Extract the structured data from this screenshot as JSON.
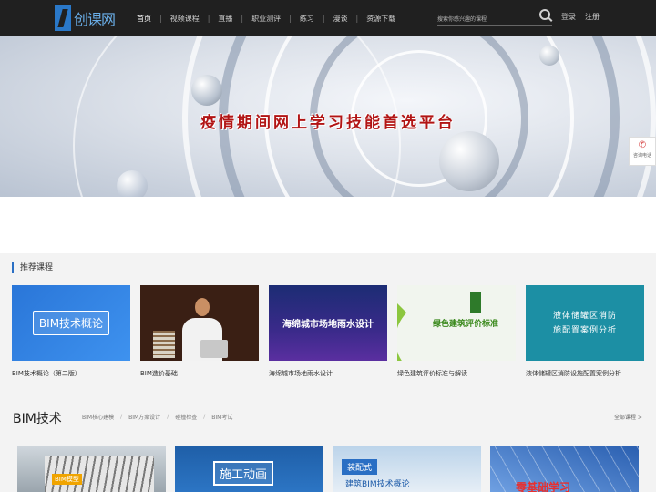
{
  "header": {
    "logo_text": "创课网",
    "nav": [
      {
        "label": "首页",
        "active": true
      },
      {
        "label": "视频课程",
        "active": false
      },
      {
        "label": "直播",
        "active": false
      },
      {
        "label": "职业测评",
        "active": false
      },
      {
        "label": "练习",
        "active": false
      },
      {
        "label": "漫谈",
        "active": false
      },
      {
        "label": "资源下载",
        "active": false
      }
    ],
    "search_placeholder": "搜索你感兴趣的课程",
    "login": "登录",
    "register": "注册"
  },
  "banner": {
    "title": "疫情期间网上学习技能首选平台"
  },
  "consult": {
    "label": "咨询电话",
    "icon": "phone-icon"
  },
  "recommended": {
    "title": "推荐课程",
    "courses": [
      {
        "title": "BIM技术概论（第二版）",
        "thumb_text": "BIM技术概论"
      },
      {
        "title": "BIM造价基础",
        "thumb_text": ""
      },
      {
        "title": "海绵城市场地雨水设计",
        "thumb_text": "海绵城市场地雨水设计"
      },
      {
        "title": "绿色建筑评价标准与解读",
        "thumb_text": "绿色建筑评价标准"
      },
      {
        "title": "液体储罐区消防设施配置案例分析",
        "thumb_line1": "液体储罐区消防",
        "thumb_line2": "施配置案例分析"
      }
    ]
  },
  "bim": {
    "title": "BIM技术",
    "subnav": [
      "BIM核心建模",
      "BIM方案设计",
      "碰撞检查",
      "BIM考试"
    ],
    "all_link": "全部课程 >",
    "cards": [
      {
        "tag": "BIM模型"
      },
      {
        "box_text": "施工动画"
      },
      {
        "tag": "装配式",
        "text": "建筑BIM技术概论"
      },
      {
        "text": "零基础学习"
      }
    ]
  },
  "colors": {
    "header_bg": "#202020",
    "accent": "#2a6fc4",
    "banner_title": "#b21515"
  }
}
